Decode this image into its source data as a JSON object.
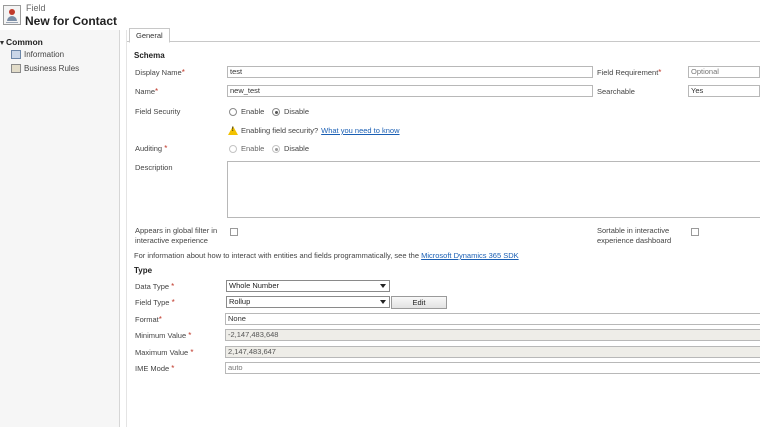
{
  "header": {
    "subtitle": "Field",
    "title": "New for Contact"
  },
  "nav": {
    "group": "Common",
    "items": [
      {
        "label": "Information",
        "icon": "form-icon"
      },
      {
        "label": "Business Rules",
        "icon": "rules-icon"
      }
    ]
  },
  "tabs": [
    {
      "label": "General"
    }
  ],
  "schema": {
    "heading": "Schema",
    "display_name": {
      "label": "Display Name",
      "value": "test"
    },
    "name": {
      "label": "Name",
      "value": "new_test"
    },
    "field_requirement": {
      "label": "Field Requirement",
      "value": "Optional"
    },
    "searchable": {
      "label": "Searchable",
      "value": "Yes"
    },
    "field_security": {
      "label": "Field Security",
      "enable": "Enable",
      "disable": "Disable"
    },
    "warning": {
      "text": "Enabling field security?",
      "link": "What you need to know"
    },
    "auditing": {
      "label": "Auditing",
      "enable": "Enable",
      "disable": "Disable"
    },
    "description": {
      "label": "Description",
      "value": ""
    },
    "global_filter": {
      "line1": "Appears in global filter in",
      "line2": "interactive experience"
    },
    "sortable": {
      "line1": "Sortable in interactive",
      "line2": "experience dashboard"
    }
  },
  "info": {
    "text": "For information about how to interact with entities and fields programmatically, see the",
    "link": "Microsoft Dynamics 365 SDK"
  },
  "type": {
    "heading": "Type",
    "data_type": {
      "label": "Data Type",
      "value": "Whole Number"
    },
    "field_type": {
      "label": "Field Type",
      "value": "Rollup",
      "edit": "Edit"
    },
    "format": {
      "label": "Format",
      "value": "None"
    },
    "min": {
      "label": "Minimum Value",
      "value": "-2,147,483,648"
    },
    "max": {
      "label": "Maximum Value",
      "value": "2,147,483,647"
    },
    "ime": {
      "label": "IME Mode",
      "value": "auto"
    }
  },
  "colors": {
    "required": "#c0392b",
    "link": "#1a5fb4",
    "readonly_bg": "#eeede8"
  }
}
